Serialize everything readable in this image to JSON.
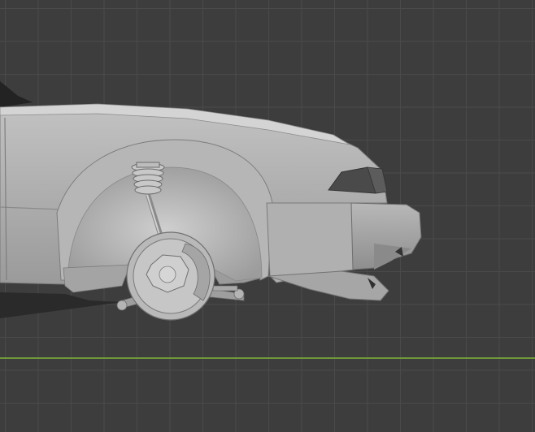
{
  "viewport": {
    "kind": "3D viewport",
    "background_color": "#3d3d3d",
    "grid_color": "#4a4a4a",
    "x_axis_color": "#6e9a3a",
    "model_color": "#a8a8a8"
  },
  "model": {
    "object": "car-front-section",
    "shading": "solid"
  }
}
